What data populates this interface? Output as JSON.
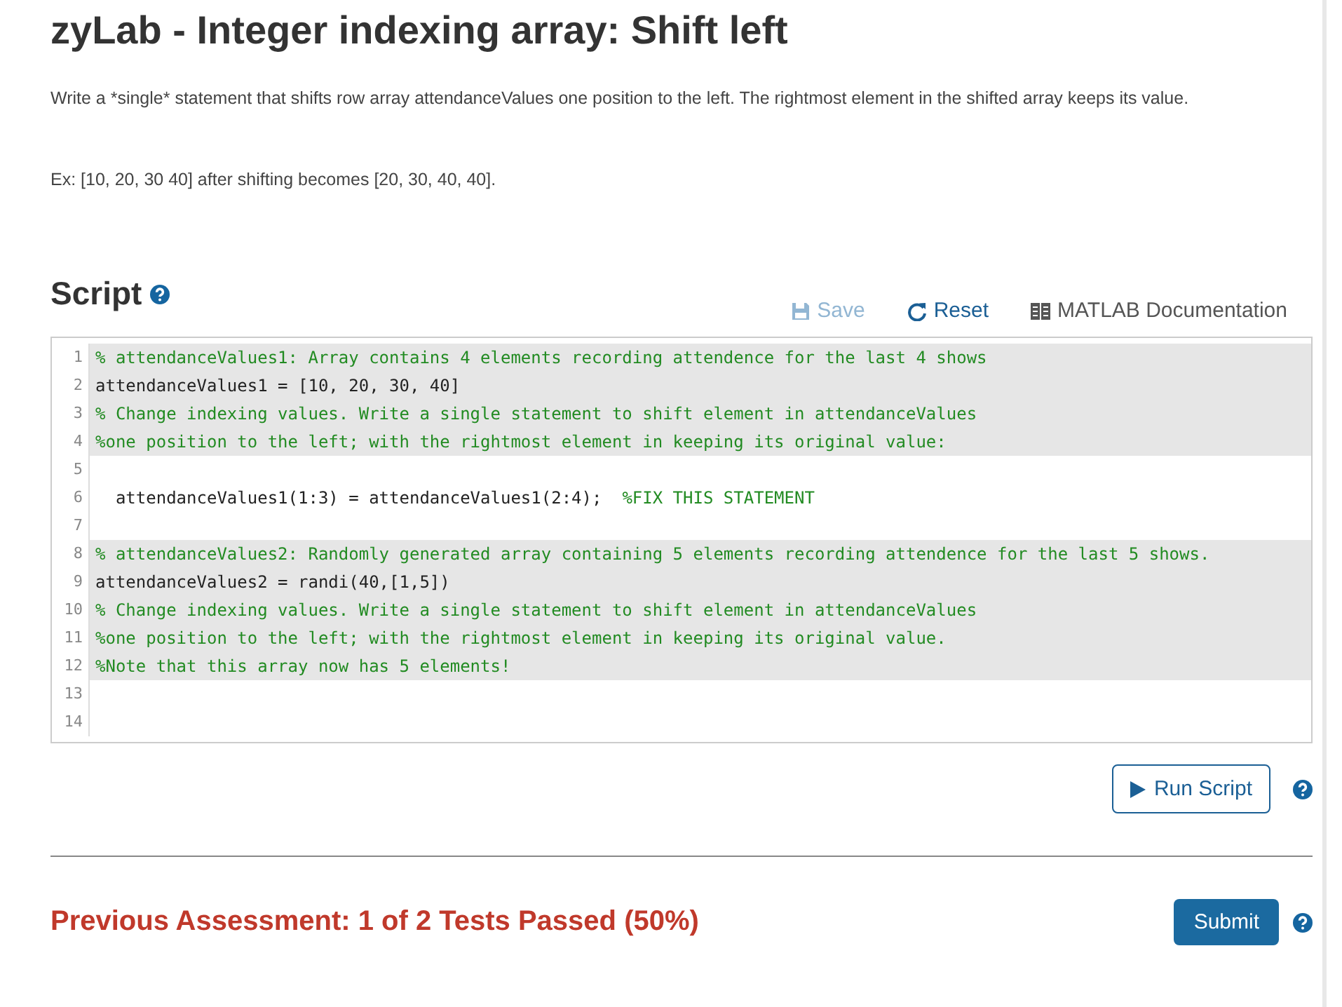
{
  "title": "zyLab - Integer indexing array: Shift left",
  "description": [
    "Write a *single* statement that shifts row array attendanceValues one position to the left. The rightmost element in the shifted array keeps its value.",
    "Ex: [10, 20, 30 40] after shifting becomes [20, 30, 40, 40]."
  ],
  "script": {
    "heading": "Script",
    "toolbar": [
      {
        "kind": "save",
        "label": "Save",
        "disabled": true
      },
      {
        "kind": "reset",
        "label": "Reset",
        "disabled": false
      },
      {
        "kind": "docs",
        "label": "MATLAB Documentation",
        "disabled": false
      }
    ]
  },
  "editor": {
    "lines": [
      {
        "number": "1",
        "locked": true,
        "segments": [
          {
            "kind": "comment",
            "text": "% attendanceValues1: Array contains 4 elements recording attendence for the last 4 shows"
          }
        ]
      },
      {
        "number": "2",
        "locked": true,
        "segments": [
          {
            "kind": "code",
            "text": "attendanceValues1 = [10, 20, 30, 40]"
          }
        ]
      },
      {
        "number": "3",
        "locked": true,
        "segments": [
          {
            "kind": "comment",
            "text": "% Change indexing values. Write a single statement to shift element in attendanceValues"
          }
        ]
      },
      {
        "number": "4",
        "locked": true,
        "segments": [
          {
            "kind": "comment",
            "text": "%one position to the left; with the rightmost element in keeping its original value:"
          }
        ]
      },
      {
        "number": "5",
        "locked": false
      },
      {
        "number": "6",
        "locked": false,
        "segments": [
          {
            "kind": "code",
            "text": "  attendanceValues1(1:3) = attendanceValues1(2:4);  "
          },
          {
            "kind": "comment",
            "text": "%FIX THIS STATEMENT"
          }
        ]
      },
      {
        "number": "7",
        "locked": false
      },
      {
        "number": "8",
        "locked": true,
        "segments": [
          {
            "kind": "comment",
            "text": "% attendanceValues2: Randomly generated array containing 5 elements recording attendence for the last 5 shows."
          }
        ]
      },
      {
        "number": "9",
        "locked": true,
        "segments": [
          {
            "kind": "code",
            "text": "attendanceValues2 = randi(40,[1,5])"
          }
        ]
      },
      {
        "number": "10",
        "locked": true,
        "segments": [
          {
            "kind": "comment",
            "text": "% Change indexing values. Write a single statement to shift element in attendanceValues"
          }
        ]
      },
      {
        "number": "11",
        "locked": true,
        "segments": [
          {
            "kind": "comment",
            "text": "%one position to the left; with the rightmost element in keeping its original value."
          }
        ]
      },
      {
        "number": "12",
        "locked": true,
        "segments": [
          {
            "kind": "comment",
            "text": "%Note that this array now has 5 elements!"
          }
        ]
      },
      {
        "number": "13",
        "locked": false
      },
      {
        "number": "14",
        "locked": false
      }
    ]
  },
  "run_button": {
    "label": "Run Script"
  },
  "assessment": {
    "text": "Previous Assessment: 1 of 2 Tests Passed (50%)",
    "submit": "Submit"
  }
}
